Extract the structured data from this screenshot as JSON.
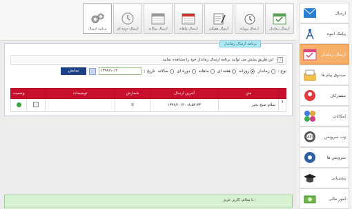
{
  "toolbar": [
    {
      "label": "برنامه ارسال",
      "icon": "gears-icon"
    },
    {
      "label": "ارسال دوره ای",
      "icon": "clock-icon"
    },
    {
      "label": "ارسال سالانه",
      "icon": "calendar-year-icon"
    },
    {
      "label": "ارسال ماهانه",
      "icon": "calendar-month-icon"
    },
    {
      "label": "ارسال هفتگی",
      "icon": "pen-paper-icon"
    },
    {
      "label": "ارسال روزانه",
      "icon": "sms-clock-icon"
    },
    {
      "label": "ارسال زماندار",
      "icon": "calendar-check-icon"
    }
  ],
  "panel_title": "برنامه ارسال زماندار",
  "info_text": "این طریق بشش می توانید برنامه ارسال زماندار خود را مشاهده نمایید.",
  "filter": {
    "type_label": "نوع :",
    "options": [
      "زماندار",
      "روزانه",
      "هفته ای",
      "ماهانه",
      "دوره ای",
      "سالانه"
    ],
    "selected": "روزانه",
    "date_label": "تاریخ :",
    "date_value": "۱۳۹۷/۱۰/۲",
    "show_button": "نمایش"
  },
  "table": {
    "headers": [
      "متن",
      "آخرین ارسال",
      "شمارش",
      "توضیحات",
      "وضعیت"
    ],
    "rows": [
      {
        "index": "1",
        "text": "سلام صبح بخیر",
        "last_sent": "۱۳۹۷/۱۰/۲۰۰۸:۵۴:۳۴",
        "count": "0",
        "desc": "",
        "status": "ok"
      }
    ]
  },
  "sidebar": [
    {
      "label": "ارسال",
      "icon": "sms-envelope-icon"
    },
    {
      "label": "پیامک انبوه",
      "icon": "antenna-icon"
    },
    {
      "label": "ارسال زماندار",
      "icon": "calendar-check-icon",
      "active": true
    },
    {
      "label": "صندوق پیام ها",
      "icon": "inbox-icon"
    },
    {
      "label": "مشترکان",
      "icon": "subscribers-icon"
    },
    {
      "label": "امکانات",
      "icon": "puzzle-icon"
    },
    {
      "label": "وب سرویس",
      "icon": "api-icon"
    },
    {
      "label": "سرویس ها",
      "icon": "services-icon"
    },
    {
      "label": "پشتیبانی",
      "icon": "graduation-cap-icon"
    },
    {
      "label": "امور مالی",
      "icon": "money-icon"
    }
  ],
  "welcome": "با سلام، کاربر عزیز :"
}
